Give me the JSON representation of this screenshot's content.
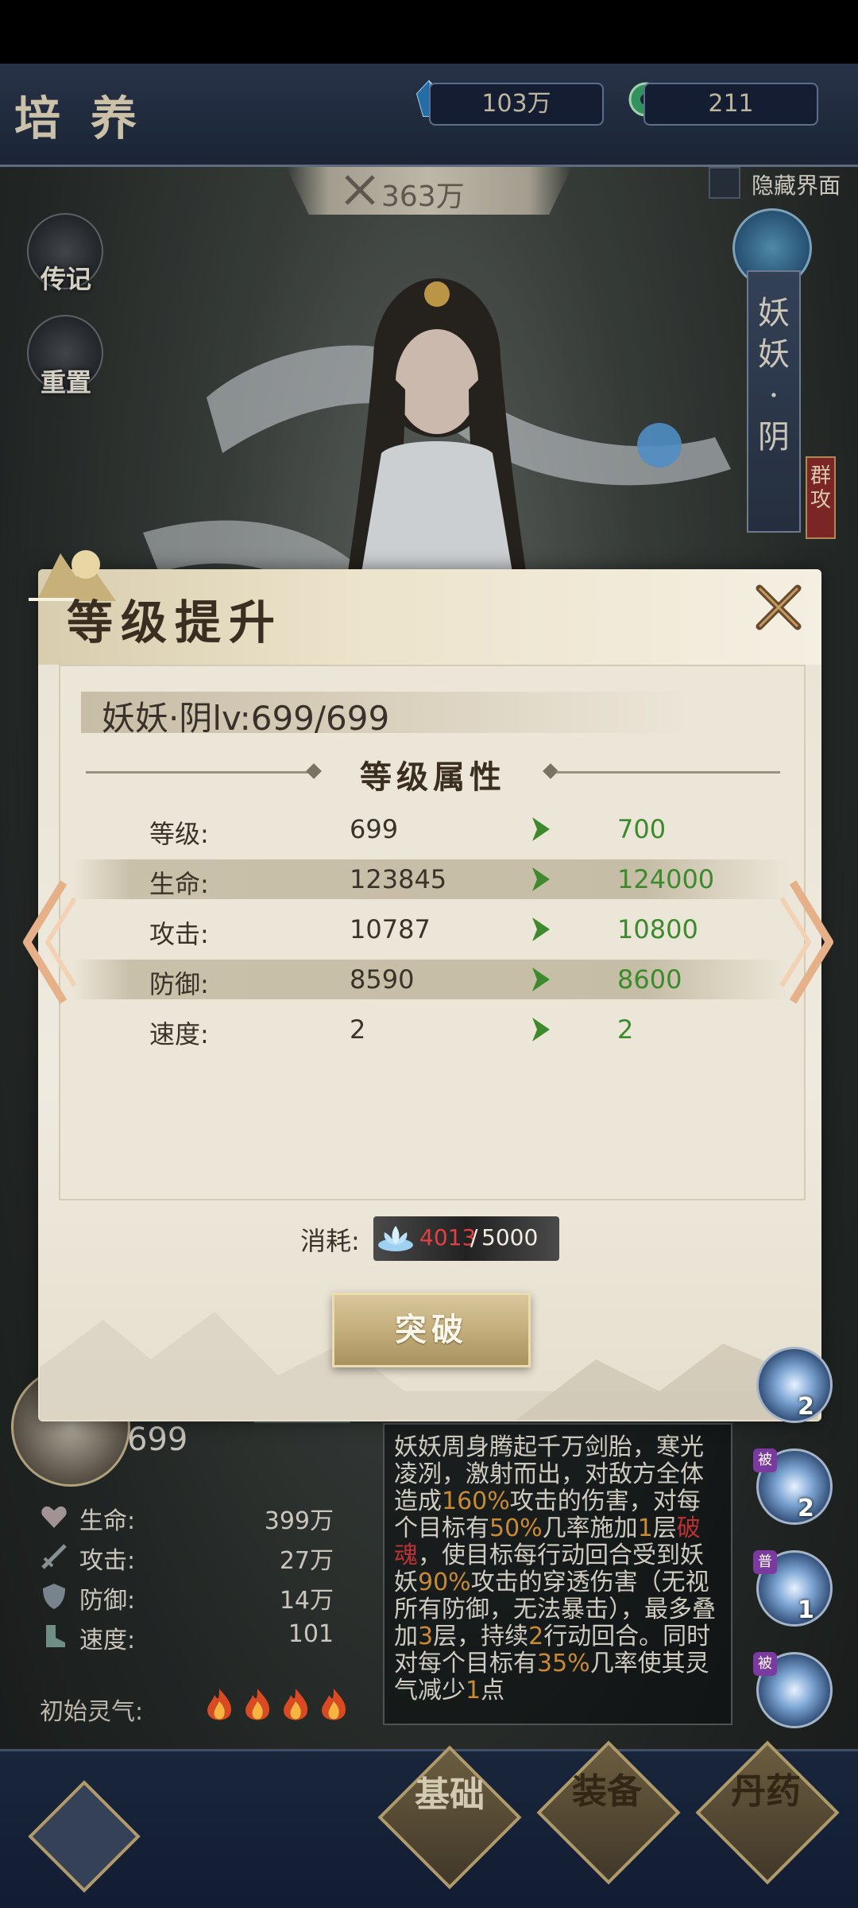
{
  "header": {
    "title": "培养",
    "crystal_amount": "103万",
    "jade_amount": "211"
  },
  "power": {
    "value": "363万"
  },
  "hide_ui": {
    "label": "隐藏界面",
    "checked": false
  },
  "side_buttons": {
    "legend": "传记",
    "reset": "重置"
  },
  "hero": {
    "name_vertical": "妖妖·阴",
    "role_tag": "群攻",
    "level": "699",
    "stats": [
      {
        "label": "生命:",
        "value": "399万",
        "icon": "heart-icon"
      },
      {
        "label": "攻击:",
        "value": "27万",
        "icon": "sword-icon"
      },
      {
        "label": "防御:",
        "value": "14万",
        "icon": "shield-icon"
      },
      {
        "label": "速度:",
        "value": "101",
        "icon": "boot-icon"
      }
    ],
    "initial_qi_label": "初始灵气:",
    "initial_qi_count": 4
  },
  "skill": {
    "parts": [
      "妖妖周身腾起千万剑胎，寒光凌冽，激射而出，对敌方全体造成",
      "160%",
      "攻击的伤害，对每个目标有",
      "50%",
      "几率施加",
      "1",
      "层",
      "破魂",
      "，使目标每行动回合受到妖妖",
      "90%",
      "攻击的穿透伤害（无视所有防御，无法暴击），最多叠加",
      "3",
      "层，持续",
      "2",
      "行动回合。同时对每个目标有",
      "35%",
      "几率使其灵气减少",
      "1",
      "点"
    ]
  },
  "skill_orbs": [
    {
      "tag": "",
      "count": "2"
    },
    {
      "tag": "被",
      "count": "2"
    },
    {
      "tag": "普",
      "count": "1"
    },
    {
      "tag": "被",
      "count": ""
    }
  ],
  "bottom_nav": {
    "basic": "基础",
    "equip": "装备",
    "pill": "丹药"
  },
  "dialog": {
    "title": "等级提升",
    "name_level": "妖妖·阴lv:699/699",
    "section_title": "等级属性",
    "rows": [
      {
        "label": "等级:",
        "old": "699",
        "new": "700"
      },
      {
        "label": "生命:",
        "old": "123845",
        "new": "124000"
      },
      {
        "label": "攻击:",
        "old": "10787",
        "new": "10800"
      },
      {
        "label": "防御:",
        "old": "8590",
        "new": "8600"
      },
      {
        "label": "速度:",
        "old": "2",
        "new": "2"
      }
    ],
    "cost_label": "消耗:",
    "cost_current": "4013",
    "cost_slash": "/",
    "cost_required": "5000",
    "breakthrough_label": "突破"
  },
  "colors": {
    "increase_green": "#3c8a2c",
    "insufficient_red": "#e04040",
    "highlight_orange": "#e59e3a"
  }
}
